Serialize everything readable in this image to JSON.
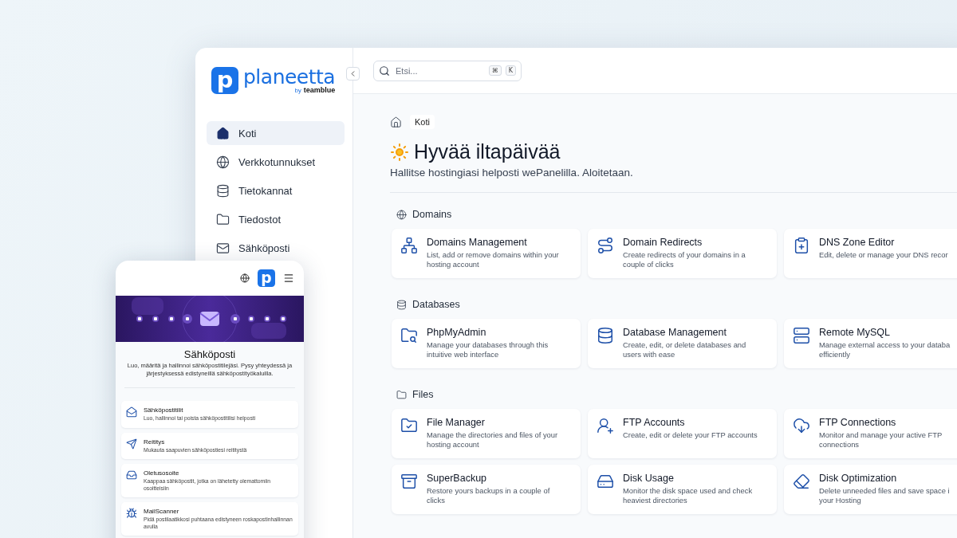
{
  "desktop": {
    "logo": {
      "mark": "p",
      "name": "planeetta",
      "by": "by",
      "brand": "teamblue"
    },
    "sidebar": {
      "items": [
        {
          "label": "Koti",
          "selected": true
        },
        {
          "label": "Verkkotunnukset",
          "selected": false
        },
        {
          "label": "Tietokannat",
          "selected": false
        },
        {
          "label": "Tiedostot",
          "selected": false
        },
        {
          "label": "Sähköposti",
          "selected": false
        }
      ]
    },
    "search": {
      "placeholder": "Etsi...",
      "keys": [
        "⌘",
        "K"
      ]
    },
    "breadcrumb": "Koti",
    "greeting": "Hyvää iltapäivää",
    "subtitle": "Hallitse hostingiasi helposti wePanelilla. Aloitetaan.",
    "sections": [
      {
        "title": "Domains",
        "cards": [
          {
            "title": "Domains Management",
            "description": "List, add or remove domains within your hosting account"
          },
          {
            "title": "Domain Redirects",
            "description": "Create redirects of your domains in a couple of clicks"
          },
          {
            "title": "DNS Zone Editor",
            "description": "Edit, delete or manage your DNS recor"
          }
        ]
      },
      {
        "title": "Databases",
        "cards": [
          {
            "title": "PhpMyAdmin",
            "description": "Manage your databases through this intuitive web interface"
          },
          {
            "title": "Database Management",
            "description": "Create, edit, or delete databases and users with ease"
          },
          {
            "title": "Remote MySQL",
            "description": "Manage external access to your databa efficiently"
          }
        ]
      },
      {
        "title": "Files",
        "cards": [
          {
            "title": "File Manager",
            "description": "Manage the directories and files of your hosting account"
          },
          {
            "title": "FTP Accounts",
            "description": "Create, edit or delete your FTP accounts"
          },
          {
            "title": "FTP Connections",
            "description": "Monitor and manage your active FTP connections"
          },
          {
            "title": "SuperBackup",
            "description": "Restore yours backups in a couple of clicks"
          },
          {
            "title": "Disk Usage",
            "description": "Monitor the disk space used and check heaviest directories"
          },
          {
            "title": "Disk Optimization",
            "description": "Delete unneeded files and save space i your Hosting"
          }
        ]
      }
    ]
  },
  "mobile": {
    "logo": {
      "mark": "p"
    },
    "title": "Sähköposti",
    "description": "Luo, määritä ja hallinnoi sähköpostitilejäsi. Pysy yhteydessä ja järjestyksessä edistyneillä sähköpostityökaluilla.",
    "cards": [
      {
        "title": "Sähköpostitilit",
        "description": "Luo, hallinnoi tai poista sähköpostitilisi helposti"
      },
      {
        "title": "Reititys",
        "description": "Mukauta saapuvien sähköpostiesi reititystä"
      },
      {
        "title": "Oletusosoite",
        "description": "Kaappaa sähköpostit, jotka on lähetetty olemattomiin osoitteisiin"
      },
      {
        "title": "MailScanner",
        "description": "Pidä postilaatikkosi puhtaana edistyneen roskapostinhallinnan avulla"
      }
    ]
  }
}
